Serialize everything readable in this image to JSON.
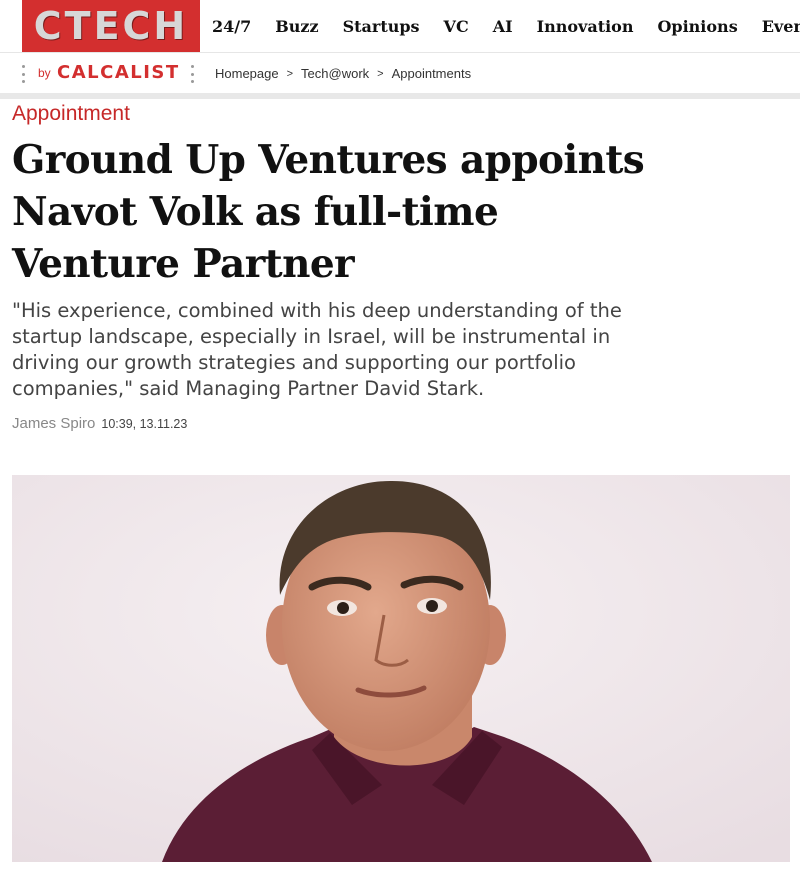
{
  "brand": {
    "logo_text": "CTECH",
    "accent": "#d32f2f"
  },
  "nav": {
    "items": [
      {
        "label": "24/7"
      },
      {
        "label": "Buzz"
      },
      {
        "label": "Startups"
      },
      {
        "label": "VC"
      },
      {
        "label": "AI"
      },
      {
        "label": "Innovation"
      },
      {
        "label": "Opinions"
      },
      {
        "label": "Events"
      }
    ]
  },
  "breadcrumb": {
    "by": "by",
    "publisher": "CALCALIST",
    "items": [
      {
        "label": "Homepage"
      },
      {
        "label": "Tech@work"
      },
      {
        "label": "Appointments"
      }
    ],
    "separator": ">"
  },
  "article": {
    "category": "Appointment",
    "headline": "Ground Up Ventures appoints Navot Volk as full-time Venture Partner",
    "subtitle": "\"His experience, combined with his deep understanding of the startup landscape, especially in Israel, will be instrumental in driving our growth strategies and supporting our portfolio companies,\" said Managing Partner David Stark.",
    "author": "James Spiro",
    "datetime": "10:39, 13.11.23"
  }
}
